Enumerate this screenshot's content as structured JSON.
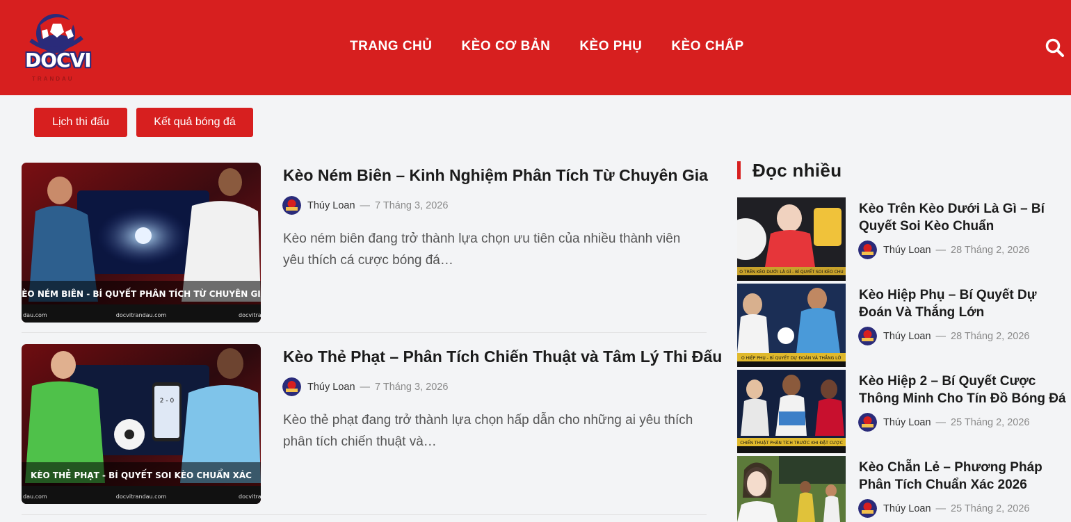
{
  "header": {
    "logo_text": "DOCVI",
    "logo_subtext": "TRANDAU",
    "nav": [
      "TRANG CHỦ",
      "KÈO CƠ BẢN",
      "KÈO PHỤ",
      "KÈO CHẤP"
    ],
    "search_icon": "search-icon"
  },
  "quick_buttons": [
    "Lịch thi đấu",
    "Kết quả bóng đá"
  ],
  "posts": [
    {
      "title": "Kèo Ném Biên – Kinh Nghiệm Phân Tích Từ Chuyên Gia",
      "author": "Thúy Loan",
      "date": "7 Tháng 3, 2026",
      "excerpt": "Kèo ném biên đang trở thành lựa chọn ưu tiên của nhiều thành viên yêu thích cá cược bóng đá…",
      "image_caption": "KÈO NÉM BIÊN - BÍ QUYẾT PHÂN TÍCH TỪ CHUYÊN GIA",
      "image_footer": [
        "dau.com",
        "docvitrandau.com",
        "docvitra"
      ]
    },
    {
      "title": "Kèo Thẻ Phạt – Phân Tích Chiến Thuật và Tâm Lý Thi Đấu",
      "author": "Thúy Loan",
      "date": "7 Tháng 3, 2026",
      "excerpt": "Kèo thẻ phạt đang trở thành lựa chọn hấp dẫn cho những ai yêu thích phân tích chiến thuật và…",
      "image_caption": "KÈO THẺ PHẠT - BÍ QUYẾT SOI KÈO CHUẨN XÁC",
      "image_footer": [
        "dau.com",
        "docvitrandau.com",
        "docvitra"
      ]
    }
  ],
  "sidebar": {
    "title": "Đọc nhiều",
    "items": [
      {
        "title": "Kèo Trên Kèo Dưới Là Gì – Bí Quyết Soi Kèo Chuẩn",
        "author": "Thúy Loan",
        "date": "28 Tháng 2, 2026",
        "caption": "O TRÊN KÈO DƯỚI LÀ GÌ - BÍ QUYẾT SOI KÈO CHU"
      },
      {
        "title": "Kèo Hiệp Phụ – Bí Quyết Dự Đoán Và Thắng Lớn",
        "author": "Thúy Loan",
        "date": "28 Tháng 2, 2026",
        "caption": "O HIỆP PHỤ - BÍ QUYẾT DỰ ĐOÁN VÀ THẮNG LỚ"
      },
      {
        "title": "Kèo Hiệp 2 – Bí Quyết Cược Thông Minh Cho Tín Đồ Bóng Đá",
        "author": "Thúy Loan",
        "date": "25 Tháng 2, 2026",
        "caption": "CHIẾN THUẬT PHÂN TÍCH TRƯỚC KHI ĐẶT CƯỢC"
      },
      {
        "title": "Kèo Chẵn Lẻ – Phương Pháp Phân Tích Chuẩn Xác 2026",
        "author": "Thúy Loan",
        "date": "25 Tháng 2, 2026",
        "caption": ""
      }
    ]
  },
  "colors": {
    "brand_red": "#d71f1f",
    "logo_navy": "#2a2b7a"
  }
}
